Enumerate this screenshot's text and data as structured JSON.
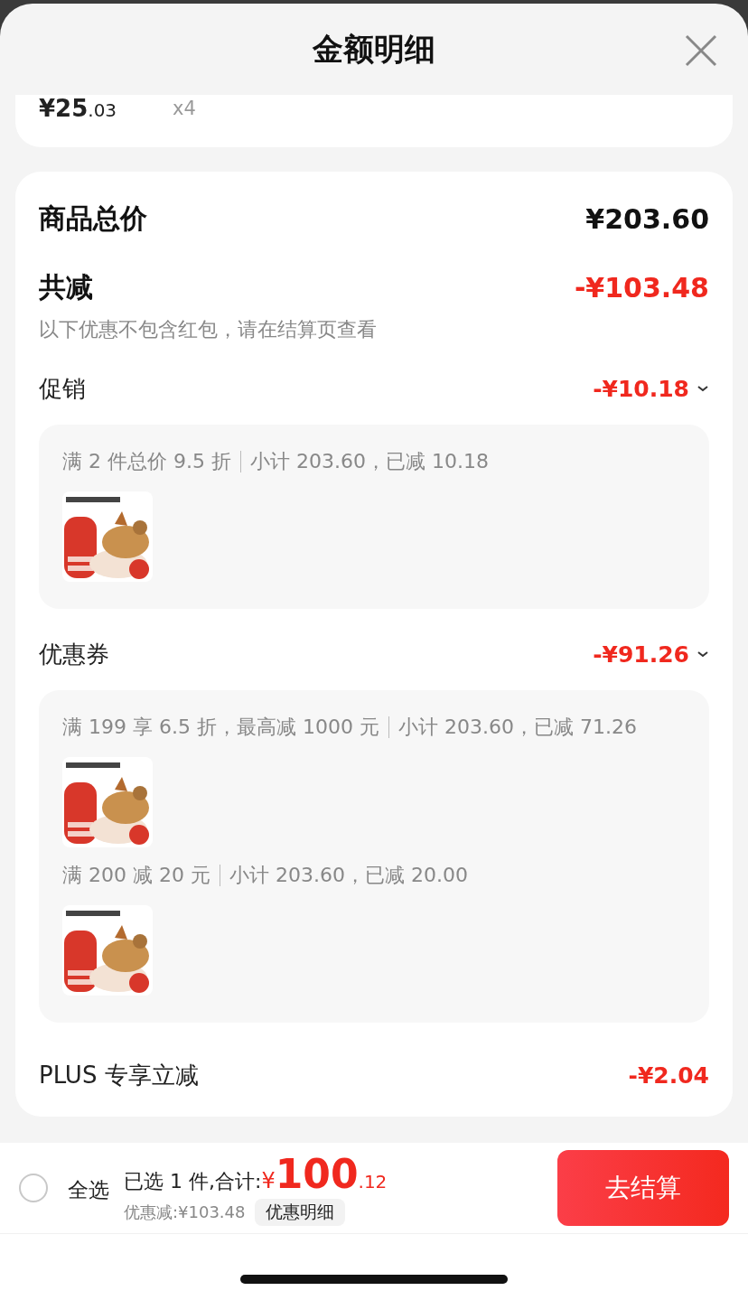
{
  "header": {
    "title": "金额明细"
  },
  "previous_item": {
    "price_int": "¥25",
    "price_dec": ".03",
    "quantity": "x4"
  },
  "summary": {
    "total_label": "商品总价",
    "total_value": "¥203.60",
    "reduce_label": "共减",
    "reduce_value": "-¥103.48",
    "note": "以下优惠不包含红包，请在结算页查看"
  },
  "sections": [
    {
      "label": "促销",
      "amount": "-¥10.18",
      "expanded": true,
      "rules": [
        {
          "condition": "满 2 件总价 9.5 折",
          "subtotal": "小计 203.60，已减 10.18"
        }
      ]
    },
    {
      "label": "优惠券",
      "amount": "-¥91.26",
      "expanded": true,
      "rules": [
        {
          "condition": "满 199 享 6.5 折，最高减 1000 元",
          "subtotal": "小计 203.60，已减 71.26"
        },
        {
          "condition": "满 200 减 20 元",
          "subtotal": "小计 203.60，已减 20.00"
        }
      ]
    }
  ],
  "plus": {
    "label": "PLUS 专享立减",
    "amount": "-¥2.04"
  },
  "bottom_bar": {
    "select_all": {
      "label": "全选",
      "checked": false
    },
    "selected_text": "已选 1 件,合计:",
    "currency": "¥",
    "total_int": "100",
    "total_dec": ".12",
    "discount": "优惠减:¥103.48",
    "detail_button": "优惠明细",
    "checkout_button": "去结算"
  }
}
